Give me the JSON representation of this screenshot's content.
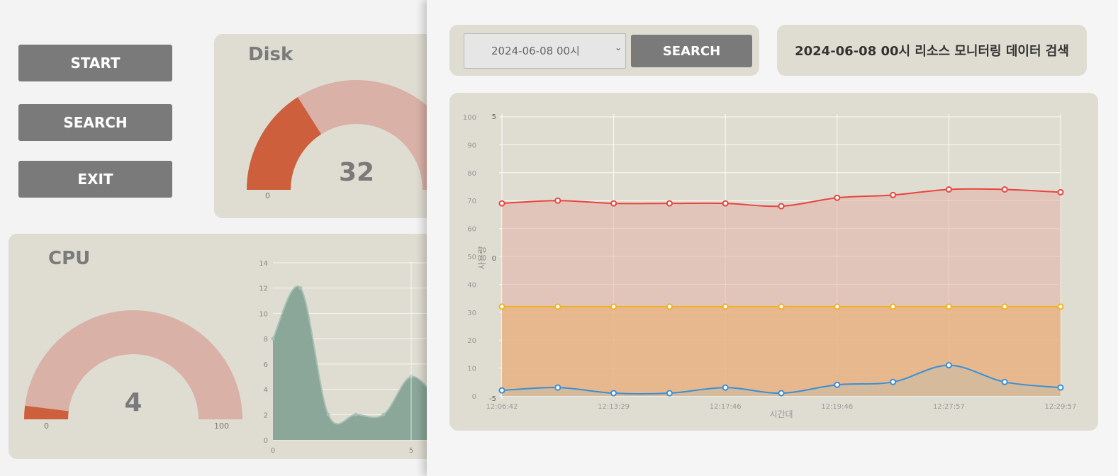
{
  "buttons": {
    "start": "START",
    "search": "SEARCH",
    "exit": "EXIT"
  },
  "disk": {
    "title": "Disk",
    "value": "32",
    "min": "0"
  },
  "cpu": {
    "title": "CPU",
    "value": "4",
    "min": "0",
    "max": "100"
  },
  "cpu_chart": {
    "y_ticks": [
      "0",
      "2",
      "4",
      "6",
      "8",
      "10",
      "12",
      "14"
    ],
    "x_ticks": [
      "0",
      "5"
    ]
  },
  "colors": {
    "gauge_fill": "#cd5f3d",
    "gauge_track": "#d9b1a7",
    "cpu_area": "#8aa79a",
    "line_red": "#e8453c",
    "line_yellow": "#f2b21e",
    "line_blue": "#3a8fd6",
    "button_bg": "#7a7a7a",
    "card_bg": "#dfddd2"
  },
  "search_panel": {
    "selected_datetime": "2024-06-08 00시",
    "search_label": "SEARCH",
    "page_title": "2024-06-08 00시 리소스 모니터링 데이터 검색"
  },
  "chart_data": {
    "type": "area",
    "xlabel": "시간대",
    "ylabel": "사용량",
    "ylim": [
      0,
      100
    ],
    "y_ticks": [
      "100",
      "90",
      "80",
      "70",
      "60",
      "50",
      "40",
      "30",
      "20",
      "10",
      "0"
    ],
    "secondary_axis_labels": [
      "5",
      "0",
      "-5"
    ],
    "x": [
      "12:06:42",
      "",
      "12:13:29",
      "",
      "12:17:46",
      "",
      "12:19:46",
      "",
      "12:27:57",
      "",
      "12:29:57"
    ],
    "series": [
      {
        "values": [
          69,
          70,
          69,
          69,
          69,
          68,
          71,
          72,
          74,
          74,
          73
        ]
      },
      {
        "values": [
          32,
          32,
          32,
          32,
          32,
          32,
          32,
          32,
          32,
          32,
          32
        ]
      },
      {
        "values": [
          2,
          3,
          1,
          1,
          3,
          1,
          4,
          5,
          11,
          5,
          3
        ]
      }
    ],
    "grid": true
  }
}
